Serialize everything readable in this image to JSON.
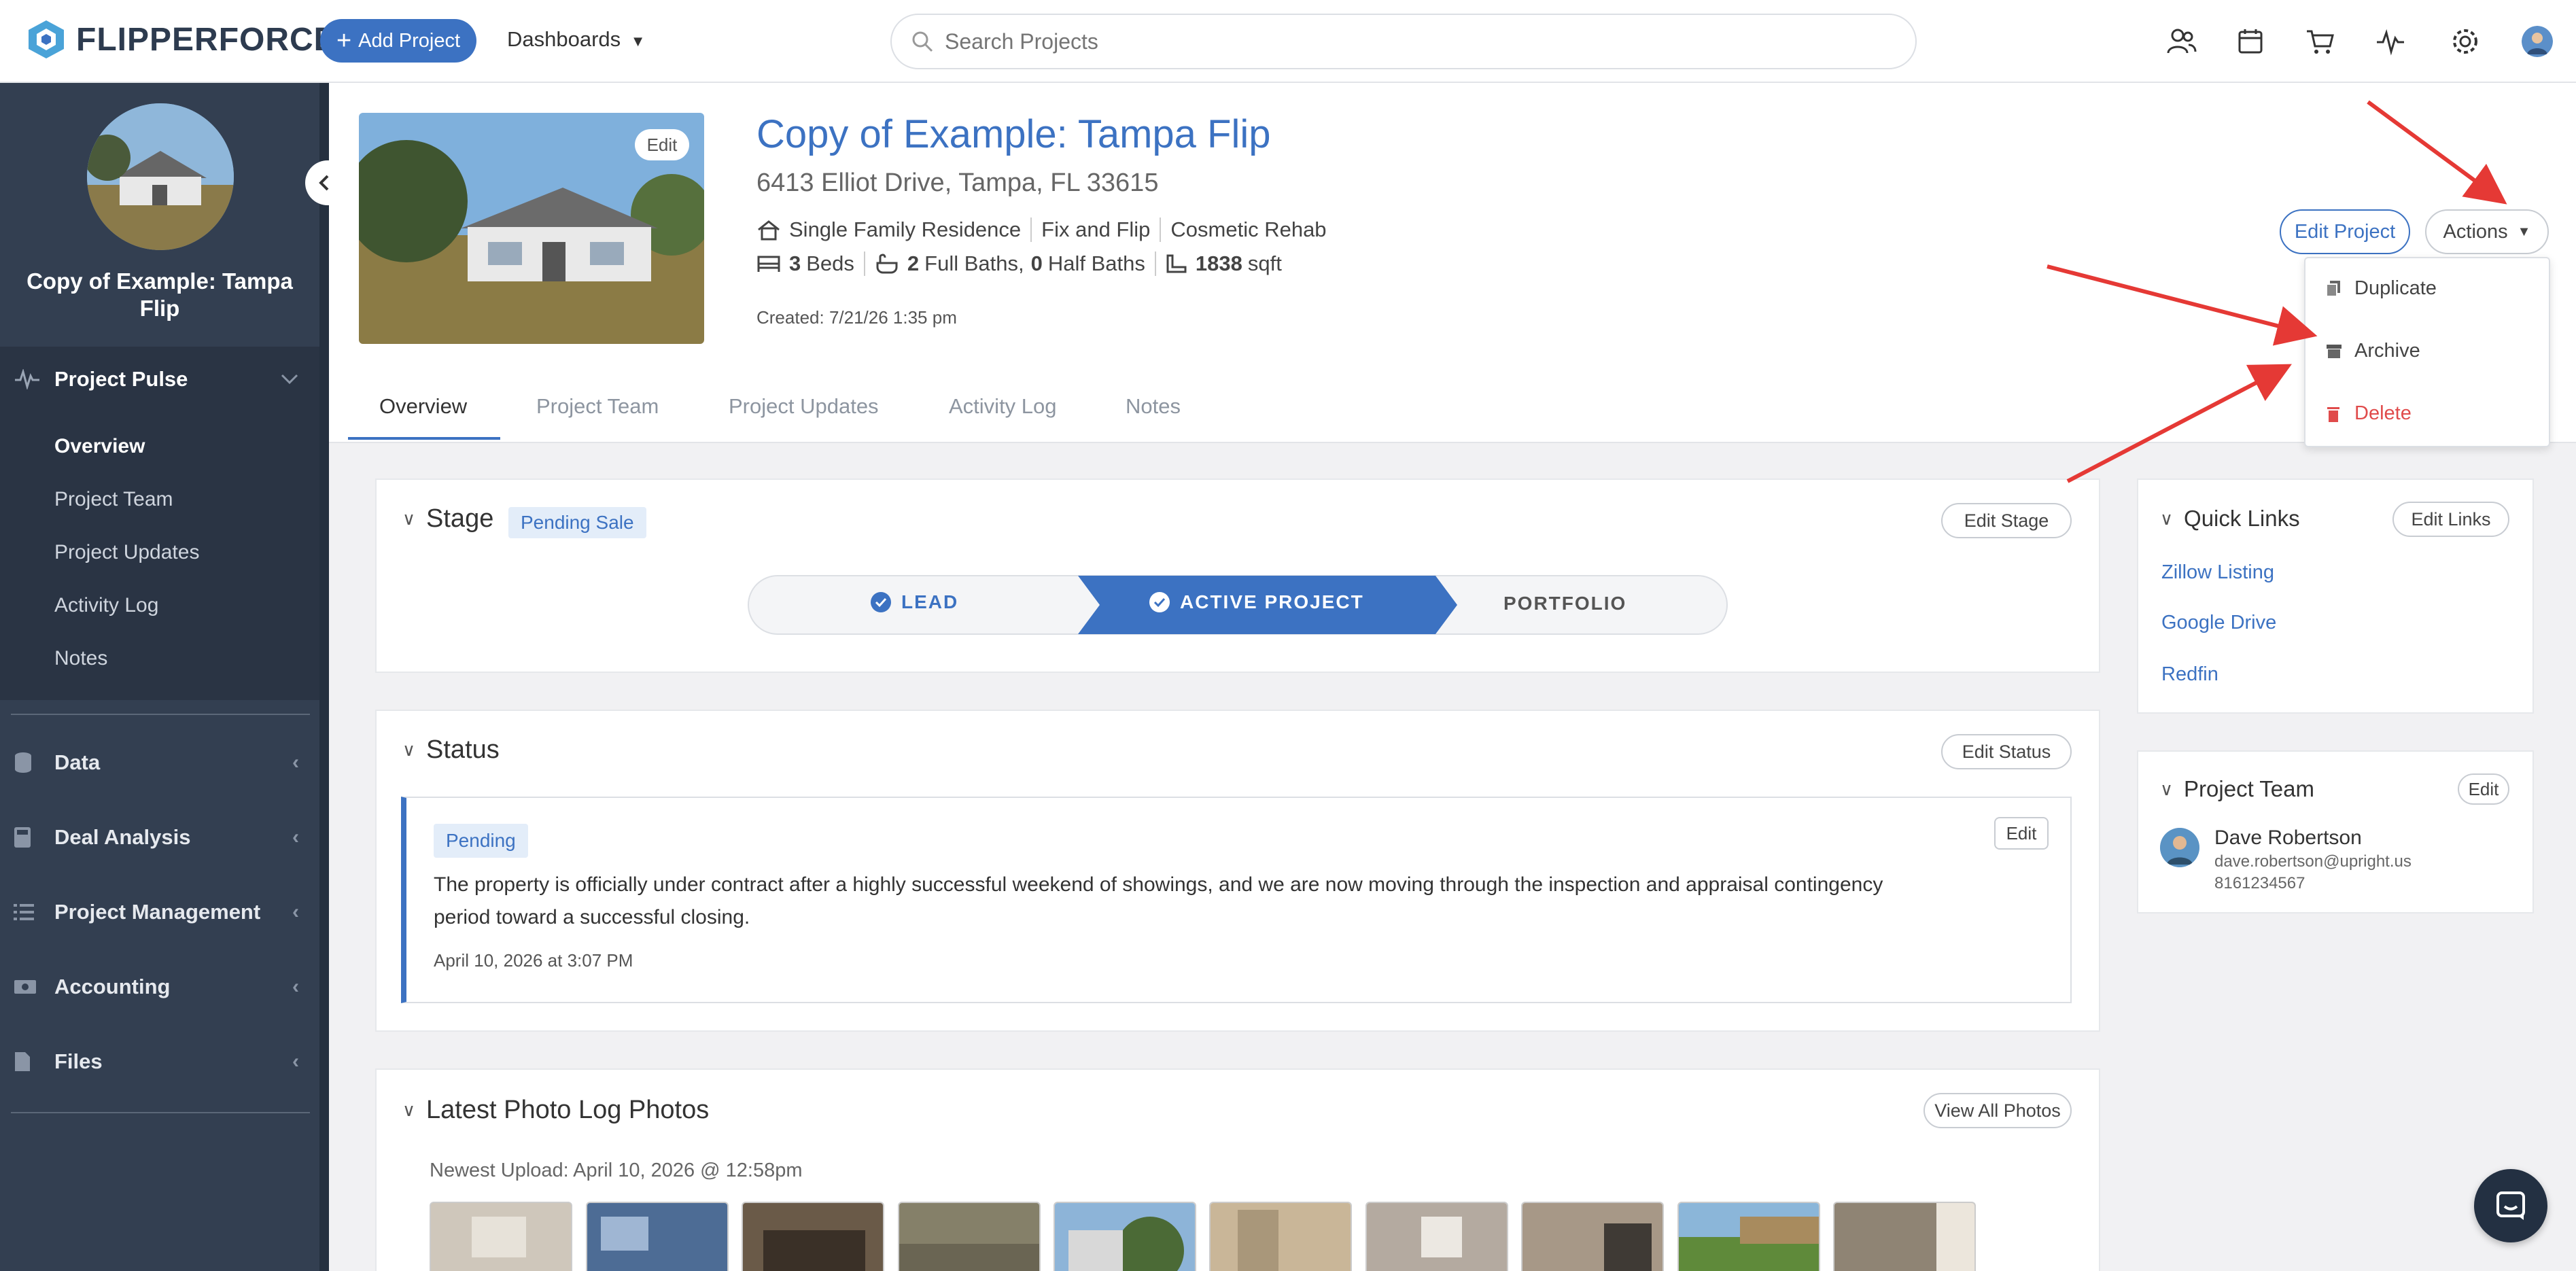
{
  "brand": {
    "name": "FLIPPERFORCE",
    "accent": "#3c72c2"
  },
  "topbar": {
    "add_project": "Add Project",
    "dashboards": "Dashboards",
    "search_placeholder": "Search Projects",
    "icons": [
      "team-icon",
      "calendar-icon",
      "cart-icon",
      "pulse-icon",
      "gear-icon",
      "user-avatar"
    ]
  },
  "sidebar": {
    "project_title": "Copy of Example: Tampa Flip",
    "pulse": {
      "label": "Project Pulse",
      "items": [
        {
          "label": "Overview",
          "active": true
        },
        {
          "label": "Project Team"
        },
        {
          "label": "Project Updates"
        },
        {
          "label": "Activity Log"
        },
        {
          "label": "Notes"
        }
      ]
    },
    "sections": [
      {
        "label": "Data",
        "icon": "database-icon"
      },
      {
        "label": "Deal Analysis",
        "icon": "calculator-icon"
      },
      {
        "label": "Project Management",
        "icon": "list-icon"
      },
      {
        "label": "Accounting",
        "icon": "money-icon"
      },
      {
        "label": "Files",
        "icon": "file-icon"
      }
    ]
  },
  "project": {
    "photo_edit": "Edit",
    "title": "Copy of Example: Tampa Flip",
    "address": "6413 Elliot Drive, Tampa, FL 33615",
    "type": "Single Family Residence",
    "strategy": "Fix and Flip",
    "rehab": "Cosmetic Rehab",
    "beds_num": "3",
    "beds_label": "Beds",
    "full_baths_num": "2",
    "full_baths_label": "Full Baths,",
    "half_baths_num": "0",
    "half_baths_label": "Half Baths",
    "sqft_num": "1838",
    "sqft_label": "sqft",
    "created": "Created: 7/21/26 1:35 pm",
    "edit_project": "Edit Project",
    "actions": "Actions"
  },
  "actions_menu": [
    {
      "label": "Duplicate",
      "icon": "copy-icon"
    },
    {
      "label": "Archive",
      "icon": "archive-icon"
    },
    {
      "label": "Delete",
      "icon": "trash-icon",
      "danger": true
    }
  ],
  "tabs": [
    "Overview",
    "Project Team",
    "Project Updates",
    "Activity Log",
    "Notes"
  ],
  "stage": {
    "heading": "Stage",
    "badge": "Pending Sale",
    "edit": "Edit Stage",
    "steps": [
      {
        "label": "LEAD",
        "done": true
      },
      {
        "label": "ACTIVE PROJECT",
        "done": true,
        "current": true
      },
      {
        "label": "PORTFOLIO",
        "done": false
      }
    ]
  },
  "status": {
    "heading": "Status",
    "edit_status": "Edit Status",
    "edit": "Edit",
    "badge": "Pending",
    "text": "The property is officially under contract after a highly successful weekend of showings, and we are now moving through the inspection and appraisal contingency period toward a successful closing.",
    "date": "April 10, 2026 at 3:07 PM"
  },
  "photos": {
    "heading": "Latest Photo Log Photos",
    "view_all": "View All Photos",
    "newest": "Newest Upload: April 10, 2026 @ 12:58pm"
  },
  "quick_links": {
    "heading": "Quick Links",
    "edit": "Edit Links",
    "links": [
      "Zillow Listing",
      "Google Drive",
      "Redfin"
    ]
  },
  "team": {
    "heading": "Project Team",
    "edit": "Edit",
    "member": {
      "name": "Dave Robertson",
      "email": "dave.robertson@upright.us",
      "phone": "8161234567"
    }
  }
}
